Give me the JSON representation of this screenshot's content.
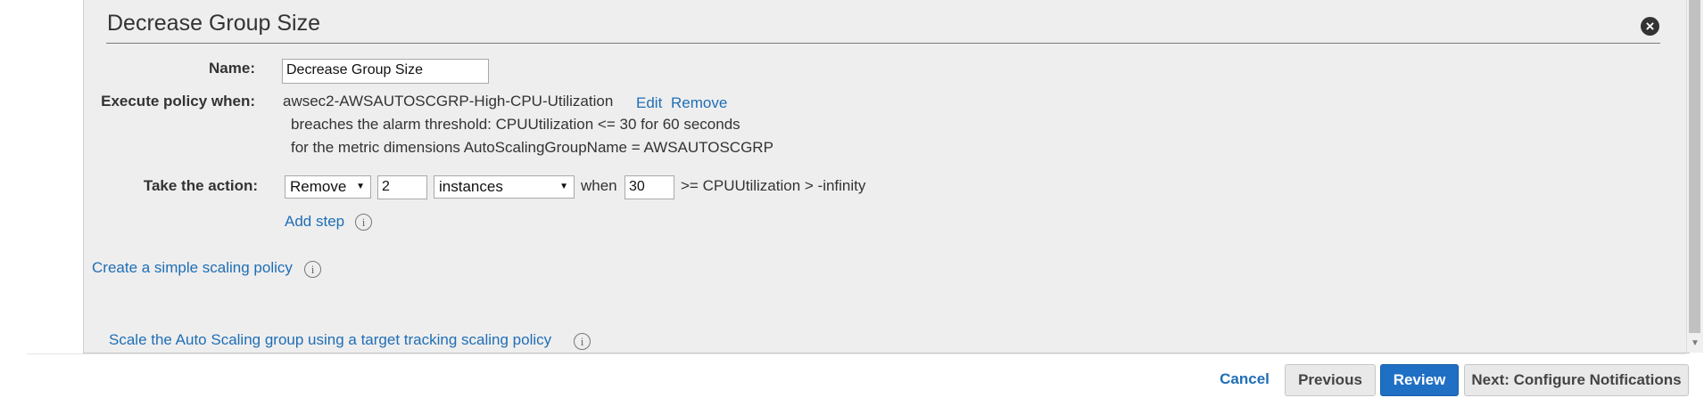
{
  "panel": {
    "title": "Decrease Group Size",
    "close_icon": "close-circle-icon"
  },
  "form": {
    "name_label": "Name:",
    "name_value": "Decrease Group Size",
    "execute_label": "Execute policy when:",
    "alarm_name": "awsec2-AWSAUTOSCGRP-High-CPU-Utilization",
    "edit_link": "Edit",
    "remove_link": "Remove",
    "alarm_line1": "breaches the alarm threshold: CPUUtilization <= 30 for 60 seconds",
    "alarm_line2": "for the metric dimensions AutoScalingGroupName = AWSAUTOSCGRP",
    "action_label": "Take the action:",
    "action_select": "Remove",
    "count_value": "2",
    "unit_select": "instances",
    "when_text": "when",
    "threshold_value": "30",
    "condition_text": ">= CPUUtilization > -infinity",
    "add_step": "Add step",
    "simple_policy_link": "Create a simple scaling policy",
    "target_tracking_link": "Scale the Auto Scaling group using a target tracking scaling policy"
  },
  "footer": {
    "cancel": "Cancel",
    "previous": "Previous",
    "review": "Review",
    "next": "Next: Configure Notifications"
  },
  "colors": {
    "link": "#1f6eb6",
    "primary": "#1f6fc5",
    "panel_bg": "#eeeeee"
  }
}
